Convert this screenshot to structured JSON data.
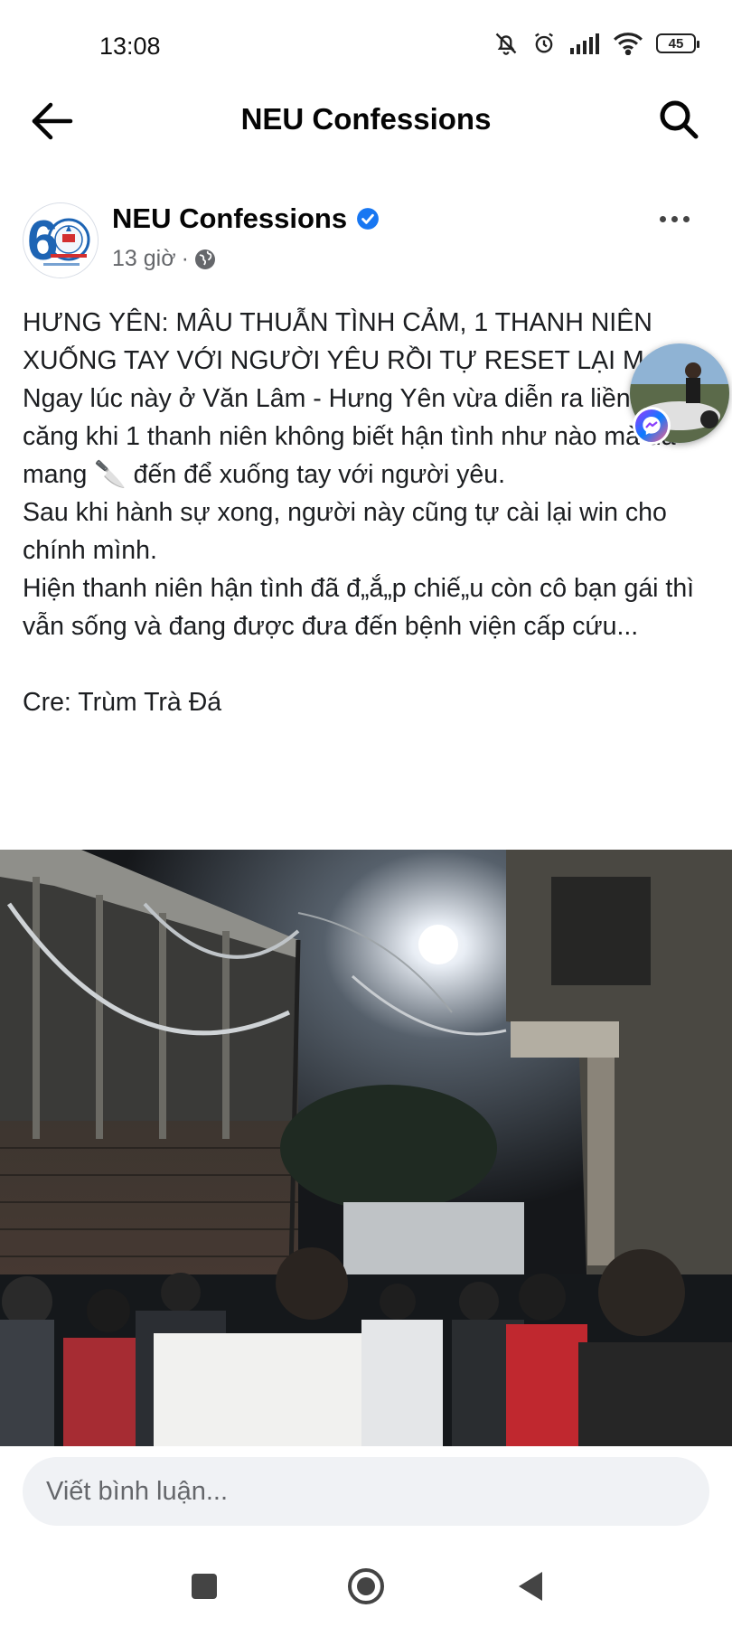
{
  "status_bar": {
    "time": "13:08",
    "battery": "45",
    "icons": [
      "bell-off-icon",
      "alarm-icon",
      "signal-icon",
      "wifi-icon",
      "battery-icon"
    ]
  },
  "header": {
    "title": "NEU Confessions",
    "back_icon": "arrow-left-icon",
    "search_icon": "search-icon"
  },
  "post": {
    "page_name": "NEU Confessions",
    "time_ago": "13 giờ",
    "separator": "·",
    "privacy_icon": "globe-icon",
    "paragraphs": [
      "HƯNG YÊN: MÂU THUẪN TÌNH CẢM, 1 THANH NIÊN XUỐNG TAY VỚI NGƯỜI YÊU RỒI TỰ RESET LẠI M„ẠNG",
      "Ngay lúc này ở Văn Lâm - Hưng Yên vừa diễn ra liền cực căng khi 1  thanh niên không biết hận tình như nào mà đã mang 🔪  đến để xuống tay với người yêu.",
      "Sau khi hành sự xong, người này cũng tự cài lại win cho chính mình.",
      "Hiện thanh niên hận tình đã đ„ắ„p chiế„u còn cô bạn gái thì vẫn sống và đang được đưa đến bệnh viện cấp cứu...",
      "",
      "Cre: Trùm Trà Đá"
    ]
  },
  "comment": {
    "placeholder": "Viết bình luận..."
  },
  "colors": {
    "verified": "#1877f2",
    "secondary_text": "#65676b",
    "input_bg": "#f0f2f5"
  }
}
